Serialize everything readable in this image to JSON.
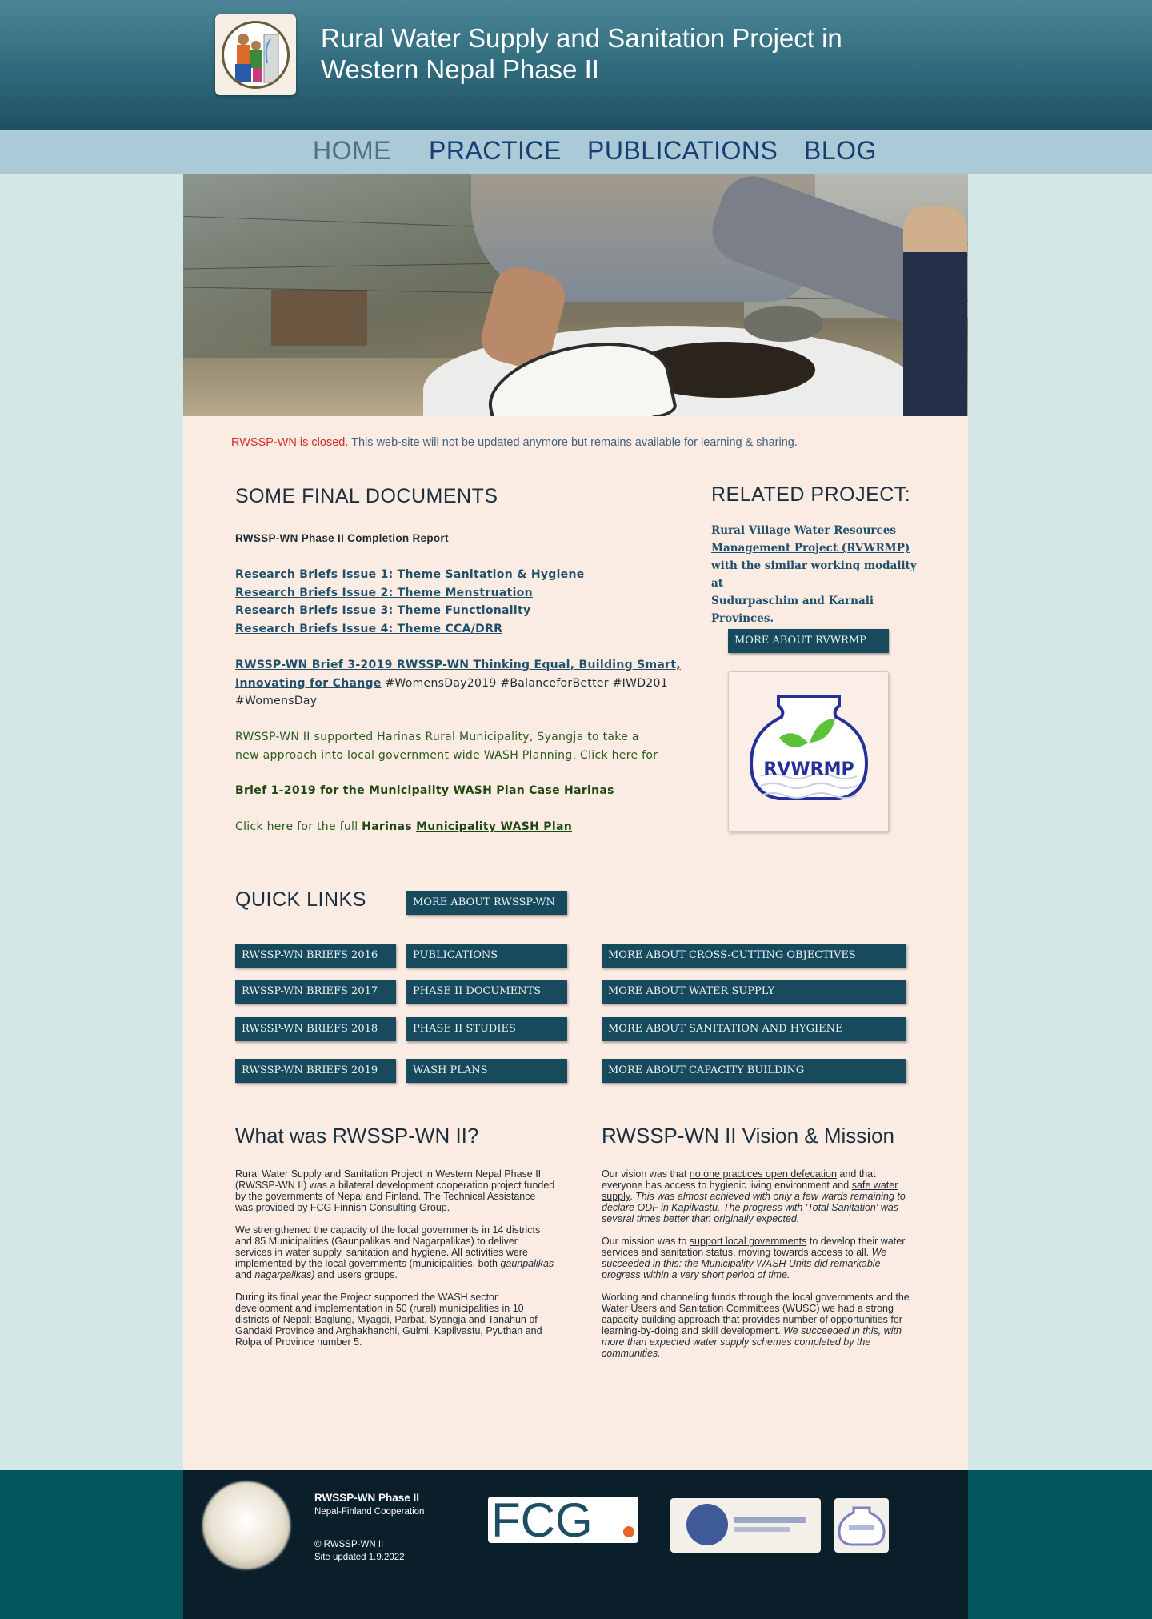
{
  "header": {
    "title": "Rural Water Supply and Sanitation Project in Western Nepal Phase II",
    "title_line1": "Rural Water Supply and Sanitation Project in",
    "title_line2": "Western Nepal Phase II"
  },
  "nav": {
    "items": [
      {
        "label": "HOME",
        "active": true
      },
      {
        "label": "PRACTICE"
      },
      {
        "label": "PUBLICATIONS"
      },
      {
        "label": "BLOG"
      }
    ]
  },
  "notice": {
    "closed": "RWSSP-WN is  closed.",
    "rest": " This web-site will not be updated anymore but remains available for learning & sharing."
  },
  "final_docs": {
    "heading": "SOME FINAL DOCUMENTS",
    "completion_report": "RWSSP-WN Phase II Completion Report",
    "research_briefs": [
      "Research Briefs Issue 1: Theme Sanitation & Hygiene",
      "Research Briefs Issue 2: Theme Menstruation",
      "Research Briefs Issue 3: Theme Functionality",
      "Research Briefs Issue 4: Theme CCA/DRR"
    ],
    "brief3_link_line1": "RWSSP-WN Brief 3-2019 RWSSP-WN Thinking Equal, Building Smart,",
    "brief3_link_line2": "Innovating for Change",
    "brief3_tags_line1": " #WomensDay2019  #BalanceforBetter #IWD201",
    "brief3_tags_line2": "#WomensDay",
    "harinas_line1": "RWSSP-WN II supported Harinas Rural Municipality, Syangja to take a",
    "harinas_line2": "new approach into local government wide WASH Planning. Click here for",
    "brief1": "Brief 1-2019 for the Municipality WASH Plan Case Harinas",
    "click_full": "Click here for the full ",
    "harinas_word": "Harinas ",
    "wash_plan": "Municipality WASH Plan"
  },
  "related": {
    "heading": "RELATED PROJECT:",
    "link_line1": "Rural Village Water Resources",
    "link_line2": "Management Project (RVWRMP)",
    "text_line1": "with the similar working modality at",
    "text_line2": "Sudurpaschim and Karnali Provinces.",
    "button": "MORE ABOUT RVWRMP",
    "logo_text": "RVWRMP"
  },
  "quick_links": {
    "heading": "QUICK LINKS",
    "more_about": "MORE ABOUT RWSSP-WN",
    "col1": [
      "RWSSP-WN BRIEFS 2016",
      "RWSSP-WN BRIEFS 2017",
      "RWSSP-WN BRIEFS 2018",
      "RWSSP-WN BRIEFS 2019"
    ],
    "col2": [
      "PUBLICATIONS",
      "PHASE II DOCUMENTS",
      "PHASE II STUDIES",
      "WASH PLANS"
    ],
    "col3": [
      "MORE ABOUT CROSS-CUTTING OBJECTIVES",
      "MORE ABOUT WATER SUPPLY",
      "MORE ABOUT SANITATION AND HYGIENE",
      "MORE ABOUT CAPACITY BUILDING"
    ]
  },
  "what_was": {
    "heading": "What was RWSSP-WN II?",
    "p1_a": "Rural Water Supply and Sanitation Project in Western Nepal Phase II (RWSSP-WN II) was a bilateral development cooperation project funded by the governments of Nepal and Finland. The Technical Assistance was provided by ",
    "p1_link": "FCG Finnish Consulting Group.",
    "p2_a": "We strengthened the capacity of the local governments in 14 districts and 85 Municipalities (Gaunpalikas and Nagarpalikas) to deliver services in water supply, sanitation and hygiene. All activities were implemented by the local governments (municipalities, both ",
    "p2_em1": "gaunpalikas",
    "p2_b": " and ",
    "p2_em2": "nagarpalikas)",
    "p2_c": " and users groups.",
    "p3": "During its final year the Project supported the WASH sector development and implementation in 50 (rural) municipalities in 10 districts of Nepal: Baglung, Myagdi, Parbat, Syangja and Tanahun of Gandaki Province and Arghakhanchi, Gulmi, Kapilvastu,  Pyuthan and Rolpa of Province number 5."
  },
  "vision": {
    "heading": "RWSSP-WN II Vision & Mission",
    "v_a": "Our vision was that ",
    "v_link1": "no one practices open defecation",
    "v_b": " and that everyone has access to hygienic living environment and ",
    "v_link2": "safe water supply",
    "v_c": ". ",
    "v_em1": "This was almost achieved with only a few wards remaining to declare ODF in Kapilvastu. The progress with '",
    "v_em_link": "Total Sanitation",
    "v_em2": "' was several times better than originally expected.",
    "m_a": "Our mission was to ",
    "m_link": "support local governments",
    "m_b": " to develop their water services and sanitation status, moving towards access to all. ",
    "m_em": "We succeeded in this: the Municipality WASH Units did remarkable progress within a very short period of time.",
    "w_a": "Working and channeling funds through the local governments and the Water Users and Sanitation Committees (WUSC) we had a strong ",
    "w_link": "capacity building approach",
    "w_b": " that provides number of opportunities for learning-by-doing and skill development. ",
    "w_em": "We succeeded in this, with  more than expected water supply schemes completed by the communities."
  },
  "footer": {
    "name": "RWSSP-WN Phase II",
    "subtitle": "Nepal-Finland Cooperation",
    "copyright": "© RWSSP-WN II",
    "updated": "Site updated 1.9.2022",
    "fcg_logo": "FCG"
  },
  "colors": {
    "header_top": "#4b8596",
    "header_bottom": "#1f5062",
    "nav_bg": "#a9cad6",
    "nav_text": "#173d73",
    "panel_bg": "#fbece3",
    "button_bg": "#174a5c",
    "footer_bg": "#0b1f2a",
    "footer_side": "#02555d",
    "notice_red": "#d42b2b"
  }
}
